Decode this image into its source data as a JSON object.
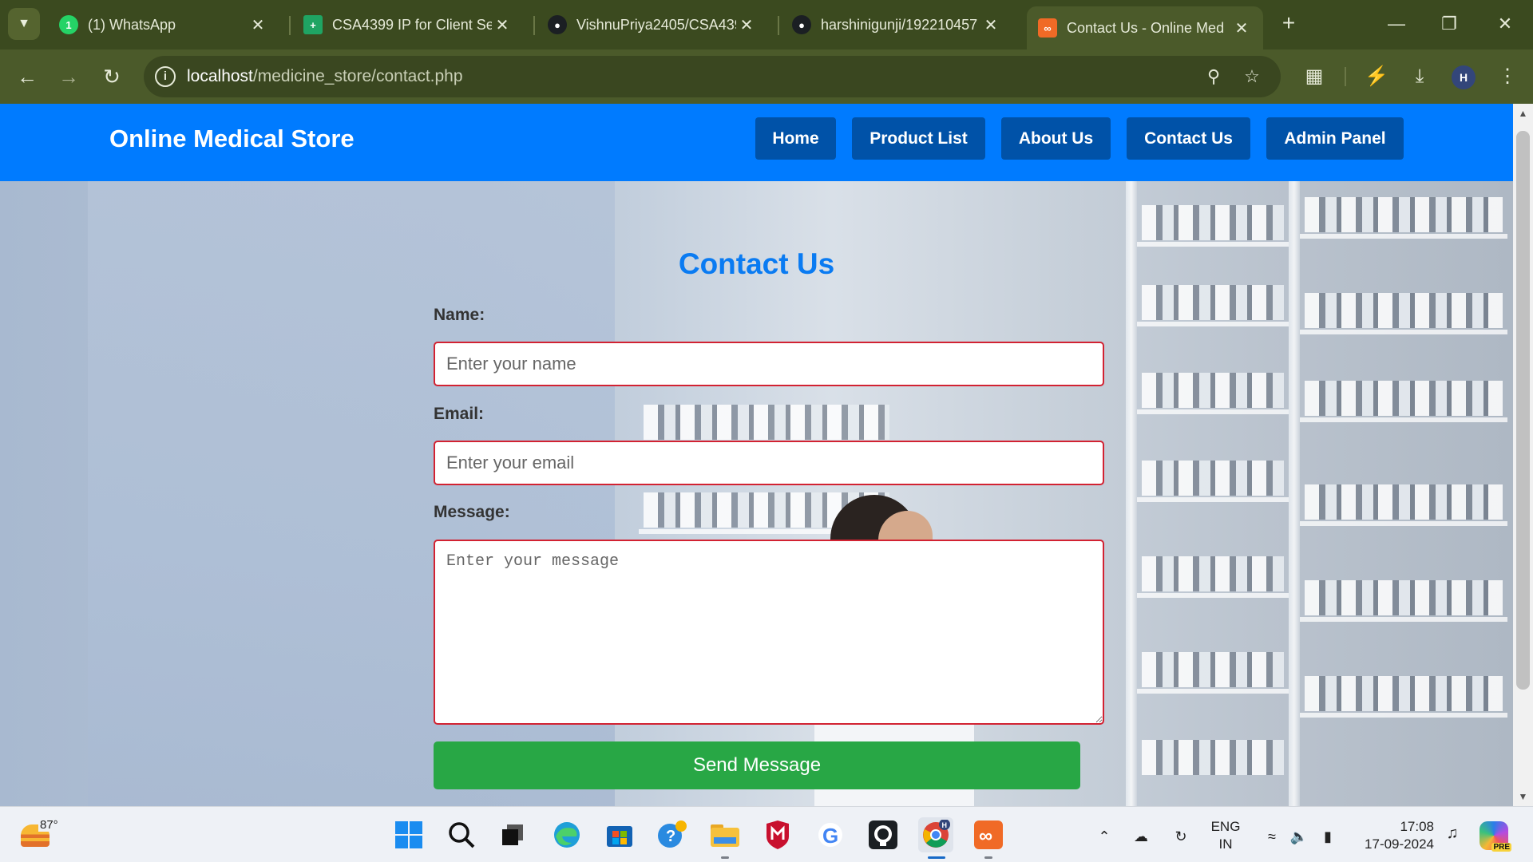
{
  "browser": {
    "tabs": [
      {
        "title": "(1) WhatsApp",
        "icon": "whatsapp-icon",
        "active": false
      },
      {
        "title": "CSA4399 IP for Client Ser",
        "icon": "google-sheets-icon",
        "active": false
      },
      {
        "title": "VishnuPriya2405/CSA439",
        "icon": "github-icon",
        "active": false
      },
      {
        "title": "harshinigunji/192210457",
        "icon": "github-icon",
        "active": false
      },
      {
        "title": "Contact Us - Online Med",
        "icon": "xampp-icon",
        "active": true
      }
    ],
    "whatsapp_badge": "1",
    "url_host": "localhost",
    "url_path": "/medicine_store/contact.php",
    "profile_initial": "H"
  },
  "site": {
    "title": "Online Medical Store",
    "nav": {
      "home": "Home",
      "products": "Product List",
      "about": "About Us",
      "contact": "Contact Us",
      "admin": "Admin Panel"
    },
    "nav_color": "#007bff",
    "nav_button_color": "#0052a8"
  },
  "form": {
    "heading": "Contact Us",
    "name_label": "Name:",
    "name_placeholder": "Enter your name",
    "email_label": "Email:",
    "email_placeholder": "Enter your email",
    "message_label": "Message:",
    "message_placeholder": "Enter your message",
    "submit_label": "Send Message",
    "input_border_color": "#d22232",
    "submit_color": "#28a745"
  },
  "taskbar": {
    "temperature": "87°",
    "pinned": [
      "start-icon",
      "search-icon",
      "task-view-icon",
      "edge-icon",
      "store-icon",
      "help-icon",
      "file-explorer-icon",
      "mcafee-icon",
      "grammarly-icon",
      "github-desktop-icon",
      "chrome-icon",
      "xampp-icon"
    ],
    "lang_line1": "ENG",
    "lang_line2": "IN",
    "time": "17:08",
    "date": "17-09-2024",
    "copilot_badge": "PRE"
  }
}
